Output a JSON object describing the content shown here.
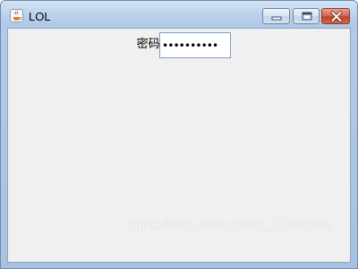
{
  "window": {
    "title": "LOL",
    "icon": "java-cup-icon"
  },
  "form": {
    "password_label": "密码:",
    "password_value": "••••••••••"
  },
  "watermark": "https://blog.csdn.net/qq_17801041",
  "colors": {
    "titlebar": "#bcd2ec",
    "client_background": "#f0f0f0",
    "close_button": "#c2432a"
  }
}
